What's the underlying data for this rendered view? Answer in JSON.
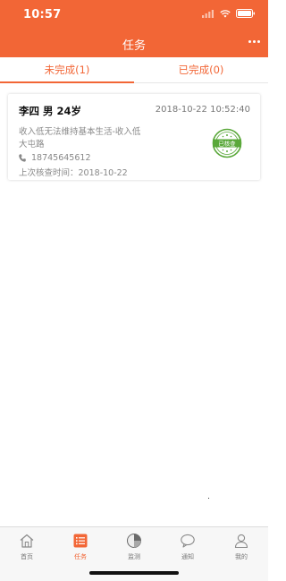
{
  "status_bar": {
    "time": "10:57"
  },
  "nav": {
    "title": "任务"
  },
  "tabs": [
    {
      "label": "未完成(1)",
      "active": true
    },
    {
      "label": "已完成(0)",
      "active": false
    }
  ],
  "task": {
    "name": "李四 男 24岁",
    "datetime": "2018-10-22 10:52:40",
    "description": "收入低无法维持基本生活-收入低",
    "address": "大屯路",
    "phone": "18745645612",
    "last_check_label": "上次核查时间：",
    "last_check_date": "2018-10-22",
    "stamp_text": "已核查"
  },
  "tabbar": [
    {
      "label": "首页",
      "icon": "home-icon",
      "active": false
    },
    {
      "label": "任务",
      "icon": "task-list-icon",
      "active": true
    },
    {
      "label": "监测",
      "icon": "monitor-pie-icon",
      "active": false
    },
    {
      "label": "通知",
      "icon": "chat-bubble-icon",
      "active": false
    },
    {
      "label": "我的",
      "icon": "user-icon",
      "active": false
    }
  ],
  "colors": {
    "accent": "#f26636",
    "stamp_green": "#5aa83a"
  }
}
